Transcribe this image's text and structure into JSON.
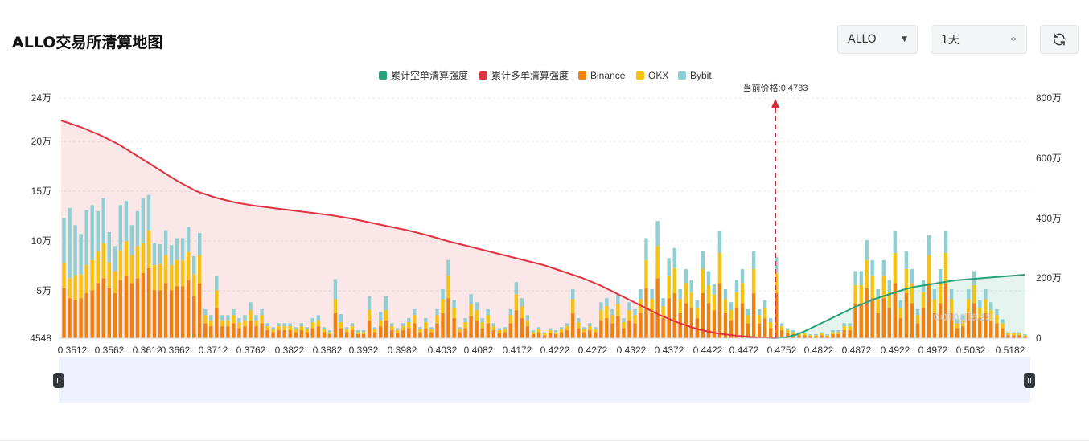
{
  "header": {
    "title": "ALLO交易所清算地图",
    "symbol_value": "ALLO",
    "range_value": "1天"
  },
  "icons": {
    "symbol_caret": "caret-down-icon",
    "range_stepper": "updown-icon",
    "refresh": "refresh-icon"
  },
  "colors": {
    "short": "#26a17b",
    "long": "#e0323f",
    "binance": "#f0810f",
    "okx": "#f6c20d",
    "bybit": "#8ecfd3"
  },
  "chart_data": {
    "type": "bar",
    "legend": [
      "累计空单清算强度",
      "累计多单清算强度",
      "Binance",
      "OKX",
      "Bybit"
    ],
    "legend_position": "top-center",
    "current_price_label": "当前价格:0.4733",
    "current_price": 0.4733,
    "left_axis_ticks": [
      "24万",
      "20万",
      "15万",
      "10万",
      "5万",
      "4548"
    ],
    "right_axis_ticks": [
      "800万",
      "600万",
      "400万",
      "200万",
      "0"
    ],
    "left_ylim": [
      4548,
      240000
    ],
    "right_ylim": [
      0,
      8000000
    ],
    "x_tick_labels": [
      "0.3512",
      "0.3562",
      "0.3612",
      "0.3662",
      "0.3712",
      "0.3762",
      "0.3822",
      "0.3882",
      "0.3932",
      "0.3982",
      "0.4032",
      "0.4082",
      "0.4172",
      "0.4222",
      "0.4272",
      "0.4322",
      "0.4372",
      "0.4422",
      "0.4472",
      "0.4752",
      "0.4822",
      "0.4872",
      "0.4922",
      "0.4972",
      "0.5032",
      "0.5182"
    ],
    "bars": {
      "binance": [
        50,
        40,
        38,
        40,
        45,
        48,
        55,
        60,
        50,
        45,
        58,
        62,
        55,
        60,
        65,
        70,
        48,
        48,
        55,
        48,
        52,
        52,
        58,
        42,
        55,
        15,
        12,
        30,
        12,
        12,
        15,
        10,
        12,
        18,
        12,
        15,
        8,
        6,
        8,
        8,
        8,
        6,
        8,
        6,
        10,
        12,
        6,
        4,
        25,
        10,
        6,
        8,
        4,
        4,
        18,
        6,
        12,
        18,
        8,
        5,
        8,
        10,
        15,
        6,
        10,
        6,
        15,
        25,
        40,
        20,
        6,
        10,
        22,
        18,
        10,
        15,
        8,
        5,
        6,
        15,
        28,
        20,
        12,
        4,
        6,
        3,
        5,
        4,
        6,
        8,
        25,
        10,
        6,
        8,
        6,
        18,
        20,
        15,
        22,
        10,
        18,
        15,
        25,
        50,
        25,
        60,
        20,
        40,
        45,
        25,
        35,
        30,
        20,
        45,
        35,
        28,
        55,
        25,
        18,
        30,
        35,
        15,
        45,
        15,
        20,
        10,
        45,
        8,
        5,
        4,
        3,
        3,
        2,
        2,
        3,
        2,
        4,
        4,
        8,
        8,
        35,
        35,
        50,
        40,
        25,
        40,
        30,
        55,
        20,
        45,
        35,
        15,
        30,
        55,
        25,
        35,
        55,
        25,
        10,
        12,
        25,
        35,
        20,
        25,
        18,
        15,
        10,
        3,
        3,
        3,
        2
      ],
      "okx": [
        25,
        20,
        25,
        24,
        28,
        30,
        32,
        35,
        26,
        22,
        30,
        35,
        28,
        32,
        30,
        38,
        25,
        26,
        28,
        25,
        26,
        26,
        28,
        22,
        28,
        8,
        6,
        18,
        6,
        6,
        8,
        6,
        6,
        10,
        6,
        8,
        4,
        3,
        4,
        4,
        4,
        3,
        4,
        3,
        6,
        6,
        3,
        2,
        14,
        6,
        3,
        4,
        2,
        2,
        10,
        3,
        6,
        10,
        4,
        3,
        4,
        6,
        8,
        3,
        6,
        3,
        8,
        14,
        22,
        10,
        3,
        6,
        12,
        10,
        6,
        8,
        4,
        3,
        3,
        8,
        16,
        12,
        6,
        2,
        3,
        2,
        3,
        2,
        3,
        4,
        14,
        6,
        3,
        4,
        3,
        10,
        12,
        8,
        12,
        6,
        10,
        8,
        14,
        28,
        14,
        32,
        12,
        22,
        25,
        14,
        20,
        16,
        10,
        24,
        18,
        16,
        30,
        14,
        10,
        16,
        20,
        8,
        24,
        8,
        10,
        6,
        20,
        4,
        3,
        2,
        2,
        2,
        1,
        1,
        2,
        1,
        2,
        2,
        4,
        4,
        18,
        18,
        28,
        22,
        14,
        22,
        16,
        30,
        10,
        24,
        20,
        8,
        16,
        28,
        14,
        20,
        30,
        14,
        5,
        6,
        14,
        18,
        10,
        14,
        10,
        8,
        5,
        2,
        2,
        2,
        1
      ],
      "bybit": [
        45,
        70,
        50,
        40,
        55,
        55,
        40,
        45,
        30,
        25,
        45,
        40,
        30,
        35,
        45,
        35,
        22,
        20,
        25,
        20,
        22,
        22,
        25,
        18,
        22,
        6,
        5,
        14,
        5,
        5,
        6,
        4,
        5,
        8,
        5,
        6,
        3,
        2,
        3,
        3,
        3,
        2,
        3,
        2,
        4,
        5,
        2,
        2,
        20,
        8,
        2,
        3,
        2,
        2,
        14,
        2,
        8,
        14,
        3,
        2,
        3,
        4,
        6,
        2,
        4,
        2,
        6,
        10,
        16,
        8,
        2,
        4,
        10,
        8,
        4,
        6,
        3,
        2,
        2,
        6,
        12,
        8,
        5,
        2,
        2,
        1,
        2,
        2,
        2,
        3,
        10,
        4,
        2,
        3,
        2,
        8,
        8,
        6,
        10,
        4,
        8,
        6,
        10,
        22,
        10,
        25,
        8,
        18,
        20,
        10,
        14,
        12,
        8,
        18,
        14,
        10,
        22,
        10,
        8,
        12,
        14,
        6,
        18,
        6,
        8,
        4,
        16,
        3,
        2,
        2,
        1,
        1,
        1,
        1,
        1,
        1,
        2,
        2,
        3,
        3,
        14,
        14,
        20,
        16,
        10,
        16,
        12,
        22,
        8,
        18,
        14,
        6,
        12,
        20,
        10,
        14,
        22,
        10,
        4,
        5,
        10,
        14,
        8,
        10,
        8,
        6,
        4,
        1,
        1,
        1,
        1
      ]
    }
  },
  "watermark": "coinglass"
}
